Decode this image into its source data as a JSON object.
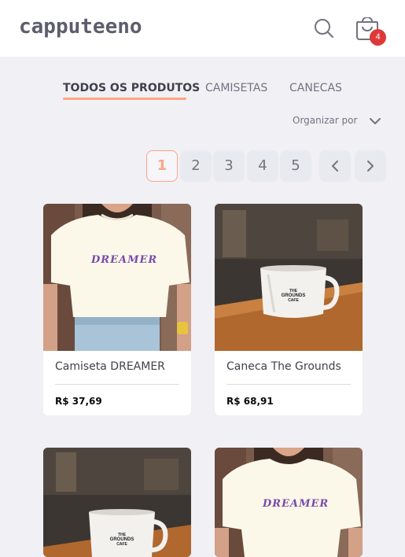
{
  "header": {
    "logo": "capputeeno",
    "cart_count": "4",
    "icons": {
      "search": "search-icon",
      "cart": "shopping-bag-icon"
    }
  },
  "tabs": [
    {
      "label": "TODOS OS PRODUTOS",
      "active": true
    },
    {
      "label": "CAMISETAS",
      "active": false
    },
    {
      "label": "CANECAS",
      "active": false
    }
  ],
  "sort": {
    "label": "Organizar por",
    "icon": "chevron-down-icon"
  },
  "pagination": {
    "pages": [
      "1",
      "2",
      "3",
      "4",
      "5"
    ],
    "current": "1",
    "icons": {
      "prev": "chevron-left-icon",
      "next": "chevron-right-icon"
    }
  },
  "products": [
    {
      "name": "Camiseta DREAMER",
      "price": "R$ 37,69",
      "image": "tshirt-photo",
      "shirt_text": "DREAMER"
    },
    {
      "name": "Caneca The Grounds",
      "price": "R$ 68,91",
      "image": "mug-photo",
      "mug_text": [
        "THE",
        "GROUNDS",
        "CAFE"
      ]
    },
    {
      "name": "",
      "price": "",
      "image": "mug-photo",
      "mug_text": [
        "THE",
        "GROUNDS",
        "CAFE"
      ]
    },
    {
      "name": "",
      "price": "",
      "image": "tshirt-photo",
      "shirt_text": "DREAMER"
    }
  ],
  "colors": {
    "accent": "#ffa585",
    "badge": "#de3838",
    "background": "#f0f0f5",
    "text": "#41414d"
  }
}
